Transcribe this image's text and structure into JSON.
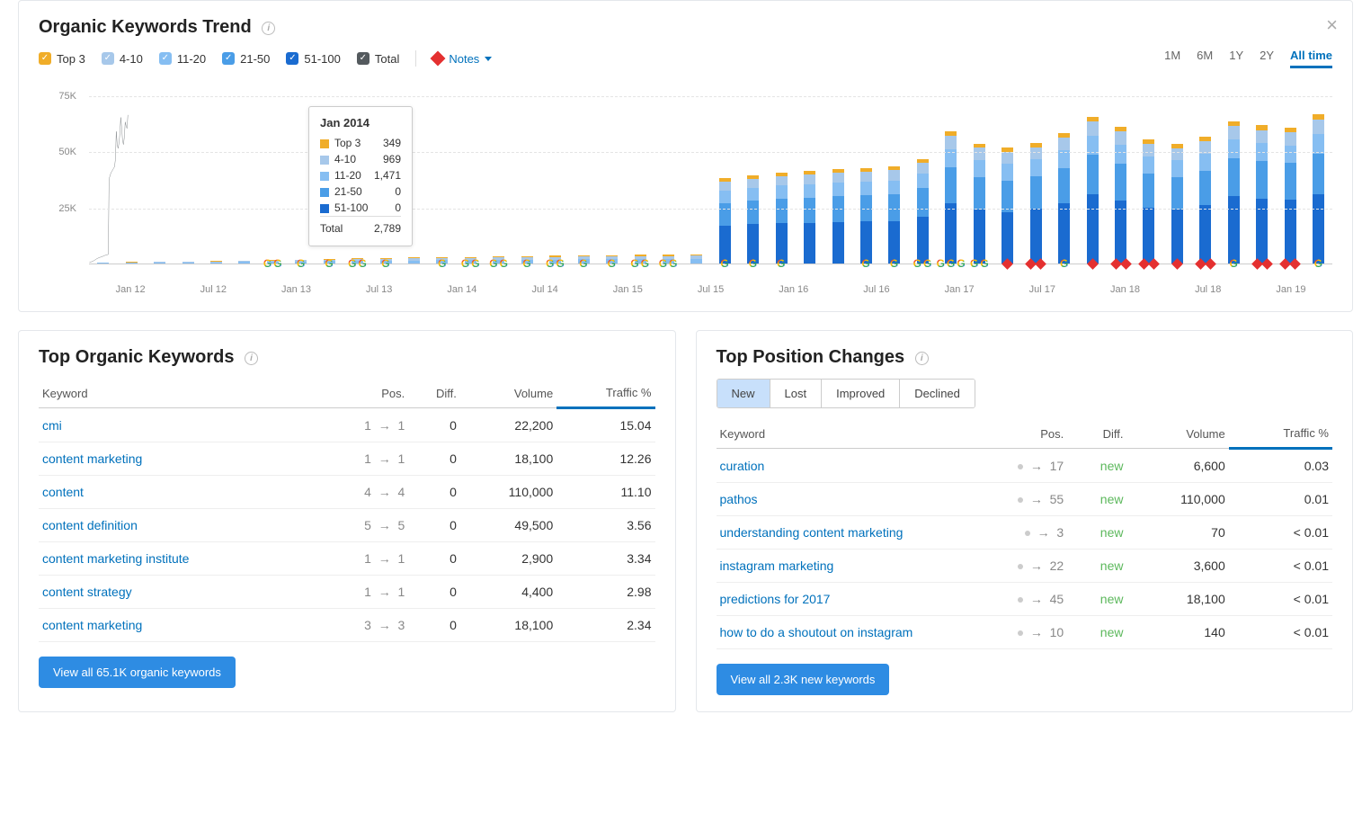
{
  "chart": {
    "title": "Organic Keywords Trend",
    "legend": [
      {
        "id": "top3",
        "label": "Top 3",
        "color": "#f0ad29"
      },
      {
        "id": "r4_10",
        "label": "4-10",
        "color": "#a7c8ea"
      },
      {
        "id": "r11_20",
        "label": "11-20",
        "color": "#86bef2"
      },
      {
        "id": "r21_50",
        "label": "21-50",
        "color": "#4a9de7"
      },
      {
        "id": "r51_100",
        "label": "51-100",
        "color": "#1a6bd0"
      },
      {
        "id": "total",
        "label": "Total",
        "color": "#545a5e"
      }
    ],
    "notes_label": "Notes",
    "ranges": [
      "1M",
      "6M",
      "1Y",
      "2Y",
      "All time"
    ],
    "active_range": "All time",
    "y_ticks": [
      "75K",
      "50K",
      "25K"
    ],
    "x_ticks": [
      "Jan 12",
      "Jul 12",
      "Jan 13",
      "Jul 13",
      "Jan 14",
      "Jul 14",
      "Jan 15",
      "Jul 15",
      "Jan 16",
      "Jul 16",
      "Jan 17",
      "Jul 17",
      "Jan 18",
      "Jul 18",
      "Jan 19"
    ]
  },
  "tooltip": {
    "title": "Jan 2014",
    "rows": [
      {
        "label": "Top 3",
        "color": "#f0ad29",
        "value": "349"
      },
      {
        "label": "4-10",
        "color": "#a7c8ea",
        "value": "969"
      },
      {
        "label": "11-20",
        "color": "#86bef2",
        "value": "1,471"
      },
      {
        "label": "21-50",
        "color": "#4a9de7",
        "value": "0"
      },
      {
        "label": "51-100",
        "color": "#1a6bd0",
        "value": "0"
      }
    ],
    "total_label": "Total",
    "total_value": "2,789"
  },
  "top_keywords": {
    "title": "Top Organic Keywords",
    "columns": [
      "Keyword",
      "Pos.",
      "Diff.",
      "Volume",
      "Traffic %"
    ],
    "rows": [
      {
        "kw": "cmi",
        "from": "1",
        "to": "1",
        "diff": "0",
        "vol": "22,200",
        "traffic": "15.04"
      },
      {
        "kw": "content marketing",
        "from": "1",
        "to": "1",
        "diff": "0",
        "vol": "18,100",
        "traffic": "12.26"
      },
      {
        "kw": "content",
        "from": "4",
        "to": "4",
        "diff": "0",
        "vol": "110,000",
        "traffic": "11.10"
      },
      {
        "kw": "content definition",
        "from": "5",
        "to": "5",
        "diff": "0",
        "vol": "49,500",
        "traffic": "3.56"
      },
      {
        "kw": "content marketing institute",
        "from": "1",
        "to": "1",
        "diff": "0",
        "vol": "2,900",
        "traffic": "3.34"
      },
      {
        "kw": "content strategy",
        "from": "1",
        "to": "1",
        "diff": "0",
        "vol": "4,400",
        "traffic": "2.98"
      },
      {
        "kw": "content marketing",
        "from": "3",
        "to": "3",
        "diff": "0",
        "vol": "18,100",
        "traffic": "2.34"
      }
    ],
    "button": "View all 65.1K organic keywords"
  },
  "top_changes": {
    "title": "Top Position Changes",
    "tabs": [
      "New",
      "Lost",
      "Improved",
      "Declined"
    ],
    "active_tab": "New",
    "columns": [
      "Keyword",
      "Pos.",
      "Diff.",
      "Volume",
      "Traffic %"
    ],
    "rows": [
      {
        "kw": "curation",
        "to": "17",
        "diff": "new",
        "vol": "6,600",
        "traffic": "0.03"
      },
      {
        "kw": "pathos",
        "to": "55",
        "diff": "new",
        "vol": "110,000",
        "traffic": "0.01"
      },
      {
        "kw": "understanding content marketing",
        "to": "3",
        "diff": "new",
        "vol": "70",
        "traffic": "< 0.01"
      },
      {
        "kw": "instagram marketing",
        "to": "22",
        "diff": "new",
        "vol": "3,600",
        "traffic": "< 0.01"
      },
      {
        "kw": "predictions for 2017",
        "to": "45",
        "diff": "new",
        "vol": "18,100",
        "traffic": "< 0.01"
      },
      {
        "kw": "how to do a shoutout on instagram",
        "to": "10",
        "diff": "new",
        "vol": "140",
        "traffic": "< 0.01"
      }
    ],
    "button": "View all 2.3K new keywords"
  },
  "chart_data": {
    "type": "bar",
    "y_max": 80000,
    "series_order": [
      "top3",
      "r4_10",
      "r11_20",
      "r21_50",
      "r51_100"
    ],
    "series_colors": {
      "top3": "#f0ad29",
      "r4_10": "#a7c8ea",
      "r11_20": "#86bef2",
      "r21_50": "#4a9de7",
      "r51_100": "#1a6bd0"
    },
    "points": [
      {
        "t": "Jan 12",
        "v": {
          "top3": 60,
          "r4_10": 150,
          "r11_20": 250,
          "r21_50": 0,
          "r51_100": 0
        },
        "icons": []
      },
      {
        "t": "Mar 12",
        "v": {
          "top3": 80,
          "r4_10": 200,
          "r11_20": 350,
          "r21_50": 0,
          "r51_100": 0
        },
        "icons": []
      },
      {
        "t": "May 12",
        "v": {
          "top3": 100,
          "r4_10": 250,
          "r11_20": 400,
          "r21_50": 0,
          "r51_100": 0
        },
        "icons": []
      },
      {
        "t": "Jul 12",
        "v": {
          "top3": 120,
          "r4_10": 300,
          "r11_20": 500,
          "r21_50": 0,
          "r51_100": 0
        },
        "icons": []
      },
      {
        "t": "Sep 12",
        "v": {
          "top3": 150,
          "r4_10": 350,
          "r11_20": 600,
          "r21_50": 0,
          "r51_100": 0
        },
        "icons": []
      },
      {
        "t": "Nov 12",
        "v": {
          "top3": 180,
          "r4_10": 400,
          "r11_20": 700,
          "r21_50": 0,
          "r51_100": 0
        },
        "icons": []
      },
      {
        "t": "Jan 13",
        "v": {
          "top3": 210,
          "r4_10": 500,
          "r11_20": 850,
          "r21_50": 0,
          "r51_100": 0
        },
        "icons": [
          "g",
          "g"
        ]
      },
      {
        "t": "Mar 13",
        "v": {
          "top3": 240,
          "r4_10": 600,
          "r11_20": 950,
          "r21_50": 0,
          "r51_100": 0
        },
        "icons": [
          "g"
        ]
      },
      {
        "t": "May 13",
        "v": {
          "top3": 280,
          "r4_10": 700,
          "r11_20": 1100,
          "r21_50": 0,
          "r51_100": 0
        },
        "icons": [
          "g"
        ]
      },
      {
        "t": "Jul 13",
        "v": {
          "top3": 300,
          "r4_10": 800,
          "r11_20": 1200,
          "r21_50": 0,
          "r51_100": 0
        },
        "icons": [
          "g",
          "g"
        ]
      },
      {
        "t": "Sep 13",
        "v": {
          "top3": 320,
          "r4_10": 850,
          "r11_20": 1300,
          "r21_50": 0,
          "r51_100": 0
        },
        "icons": [
          "g"
        ]
      },
      {
        "t": "Nov 13",
        "v": {
          "top3": 340,
          "r4_10": 900,
          "r11_20": 1400,
          "r21_50": 0,
          "r51_100": 0
        },
        "icons": []
      },
      {
        "t": "Jan 14",
        "v": {
          "top3": 349,
          "r4_10": 969,
          "r11_20": 1471,
          "r21_50": 0,
          "r51_100": 0
        },
        "icons": [
          "g"
        ]
      },
      {
        "t": "Mar 14",
        "v": {
          "top3": 380,
          "r4_10": 1000,
          "r11_20": 1550,
          "r21_50": 0,
          "r51_100": 0
        },
        "icons": [
          "g",
          "g"
        ]
      },
      {
        "t": "May 14",
        "v": {
          "top3": 400,
          "r4_10": 1050,
          "r11_20": 1600,
          "r21_50": 0,
          "r51_100": 0
        },
        "icons": [
          "g",
          "g"
        ]
      },
      {
        "t": "Jul 14",
        "v": {
          "top3": 430,
          "r4_10": 1100,
          "r11_20": 1700,
          "r21_50": 0,
          "r51_100": 0
        },
        "icons": [
          "g"
        ]
      },
      {
        "t": "Sep 14",
        "v": {
          "top3": 460,
          "r4_10": 1150,
          "r11_20": 1800,
          "r21_50": 0,
          "r51_100": 0
        },
        "icons": [
          "g",
          "g"
        ]
      },
      {
        "t": "Nov 14",
        "v": {
          "top3": 480,
          "r4_10": 1200,
          "r11_20": 1900,
          "r21_50": 0,
          "r51_100": 0
        },
        "icons": [
          "g"
        ]
      },
      {
        "t": "Jan 15",
        "v": {
          "top3": 500,
          "r4_10": 1250,
          "r11_20": 1950,
          "r21_50": 0,
          "r51_100": 0
        },
        "icons": [
          "g"
        ]
      },
      {
        "t": "Mar 15",
        "v": {
          "top3": 520,
          "r4_10": 1300,
          "r11_20": 2000,
          "r21_50": 0,
          "r51_100": 0
        },
        "icons": [
          "g",
          "g"
        ]
      },
      {
        "t": "May 15",
        "v": {
          "top3": 540,
          "r4_10": 1350,
          "r11_20": 2050,
          "r21_50": 0,
          "r51_100": 0
        },
        "icons": [
          "g",
          "g"
        ]
      },
      {
        "t": "Jul 15",
        "v": {
          "top3": 560,
          "r4_10": 1400,
          "r11_20": 2100,
          "r21_50": 0,
          "r51_100": 0
        },
        "icons": []
      },
      {
        "t": "Sep 15",
        "v": {
          "top3": 1400,
          "r4_10": 4000,
          "r11_20": 5500,
          "r21_50": 10000,
          "r51_100": 17000
        },
        "icons": [
          "g"
        ]
      },
      {
        "t": "Nov 15",
        "v": {
          "top3": 1450,
          "r4_10": 4100,
          "r11_20": 5600,
          "r21_50": 10500,
          "r51_100": 17500
        },
        "icons": [
          "g"
        ]
      },
      {
        "t": "Jan 16",
        "v": {
          "top3": 1500,
          "r4_10": 4200,
          "r11_20": 5800,
          "r21_50": 11000,
          "r51_100": 18000
        },
        "icons": [
          "g"
        ]
      },
      {
        "t": "Mar 16",
        "v": {
          "top3": 1520,
          "r4_10": 4300,
          "r11_20": 5900,
          "r21_50": 11200,
          "r51_100": 18200
        },
        "icons": []
      },
      {
        "t": "May 16",
        "v": {
          "top3": 1550,
          "r4_10": 4400,
          "r11_20": 6000,
          "r21_50": 11400,
          "r51_100": 18500
        },
        "icons": []
      },
      {
        "t": "Jul 16",
        "v": {
          "top3": 1580,
          "r4_10": 4500,
          "r11_20": 6100,
          "r21_50": 11600,
          "r51_100": 18800
        },
        "icons": [
          "g"
        ]
      },
      {
        "t": "Sep 16",
        "v": {
          "top3": 1600,
          "r4_10": 4600,
          "r11_20": 6200,
          "r21_50": 11800,
          "r51_100": 19000
        },
        "icons": [
          "g"
        ]
      },
      {
        "t": "Nov 16",
        "v": {
          "top3": 1650,
          "r4_10": 4800,
          "r11_20": 6400,
          "r21_50": 12500,
          "r51_100": 21000
        },
        "icons": [
          "g",
          "g"
        ]
      },
      {
        "t": "Jan 17",
        "v": {
          "top3": 2000,
          "r4_10": 6000,
          "r11_20": 8000,
          "r21_50": 16000,
          "r51_100": 27000
        },
        "icons": [
          "g",
          "g",
          "g"
        ]
      },
      {
        "t": "Mar 17",
        "v": {
          "top3": 1900,
          "r4_10": 5500,
          "r11_20": 7500,
          "r21_50": 14500,
          "r51_100": 24000
        },
        "icons": [
          "g",
          "g"
        ]
      },
      {
        "t": "May 17",
        "v": {
          "top3": 1850,
          "r4_10": 5300,
          "r11_20": 7300,
          "r21_50": 14000,
          "r51_100": 23000
        },
        "icons": [
          "d"
        ]
      },
      {
        "t": "Jul 17",
        "v": {
          "top3": 1900,
          "r4_10": 5400,
          "r11_20": 7400,
          "r21_50": 14500,
          "r51_100": 24500
        },
        "icons": [
          "d",
          "d"
        ]
      },
      {
        "t": "Sep 17",
        "v": {
          "top3": 1950,
          "r4_10": 5700,
          "r11_20": 7800,
          "r21_50": 15500,
          "r51_100": 27000
        },
        "icons": [
          "g"
        ]
      },
      {
        "t": "Nov 17",
        "v": {
          "top3": 2100,
          "r4_10": 6200,
          "r11_20": 8500,
          "r21_50": 17500,
          "r51_100": 31000
        },
        "icons": [
          "d"
        ]
      },
      {
        "t": "Jan 18",
        "v": {
          "top3": 2050,
          "r4_10": 6000,
          "r11_20": 8200,
          "r21_50": 16500,
          "r51_100": 28000
        },
        "icons": [
          "d",
          "d"
        ]
      },
      {
        "t": "Mar 18",
        "v": {
          "top3": 1950,
          "r4_10": 5600,
          "r11_20": 7600,
          "r21_50": 15000,
          "r51_100": 25000
        },
        "icons": [
          "d",
          "d"
        ]
      },
      {
        "t": "May 18",
        "v": {
          "top3": 1900,
          "r4_10": 5400,
          "r11_20": 7400,
          "r21_50": 14500,
          "r51_100": 24000
        },
        "icons": [
          "d"
        ]
      },
      {
        "t": "Jul 18",
        "v": {
          "top3": 1950,
          "r4_10": 5600,
          "r11_20": 7600,
          "r21_50": 15200,
          "r51_100": 26000
        },
        "icons": [
          "d",
          "d"
        ]
      },
      {
        "t": "Sep 18",
        "v": {
          "top3": 2050,
          "r4_10": 6000,
          "r11_20": 8200,
          "r21_50": 17000,
          "r51_100": 30000
        },
        "icons": [
          "g"
        ]
      },
      {
        "t": "Nov 18",
        "v": {
          "top3": 2020,
          "r4_10": 5900,
          "r11_20": 8000,
          "r21_50": 16500,
          "r51_100": 29000
        },
        "icons": [
          "d",
          "d"
        ]
      },
      {
        "t": "Jan 19",
        "v": {
          "top3": 2000,
          "r4_10": 5800,
          "r11_20": 7900,
          "r21_50": 16200,
          "r51_100": 28500
        },
        "icons": [
          "d",
          "d"
        ]
      },
      {
        "t": "Mar 19",
        "v": {
          "top3": 2200,
          "r4_10": 6400,
          "r11_20": 8800,
          "r21_50": 18000,
          "r51_100": 31000
        },
        "icons": [
          "g"
        ]
      }
    ]
  }
}
